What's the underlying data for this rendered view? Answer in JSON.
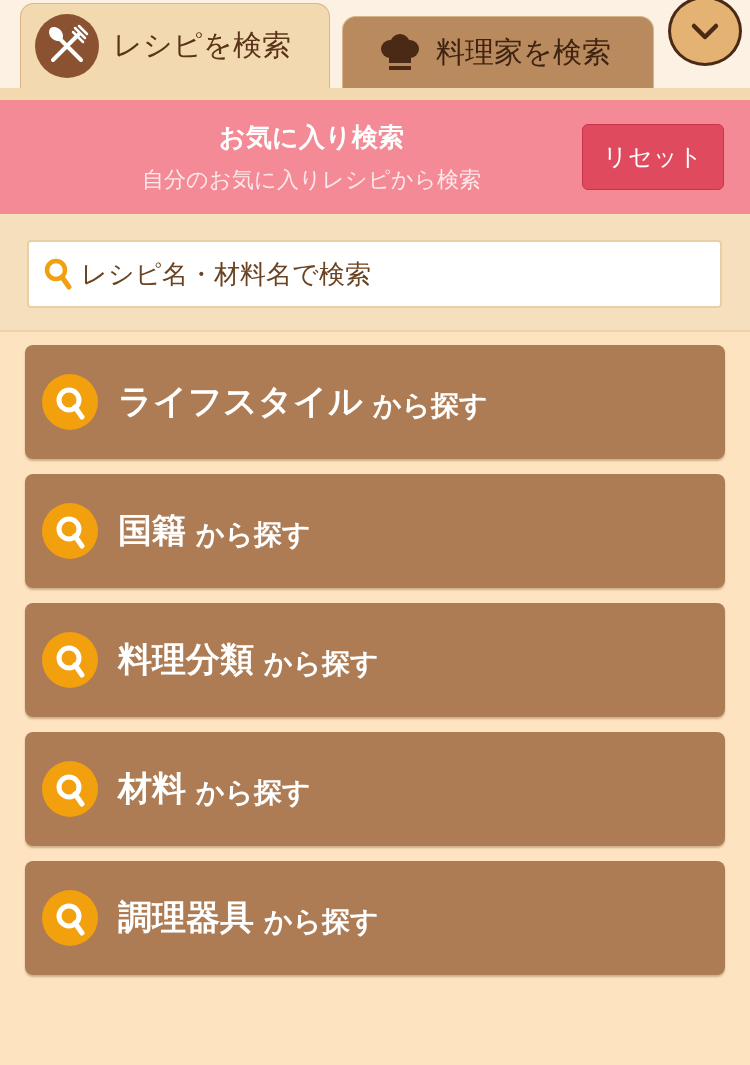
{
  "tabs": [
    {
      "label": "レシピを検索",
      "selected": true
    },
    {
      "label": "料理家を検索",
      "selected": false
    }
  ],
  "favorites_banner": {
    "title": "お気に入り検索",
    "subtitle": "自分のお気に入りレシピから検索",
    "reset_button": "リセット"
  },
  "search": {
    "placeholder": "レシピ名・材料名で検索"
  },
  "categories": [
    {
      "label": "ライフスタイル",
      "suffix": "から探す"
    },
    {
      "label": "国籍",
      "suffix": "から探す"
    },
    {
      "label": "料理分類",
      "suffix": "から探す"
    },
    {
      "label": "材料",
      "suffix": "から探す"
    },
    {
      "label": "調理器具",
      "suffix": "から探す"
    }
  ]
}
